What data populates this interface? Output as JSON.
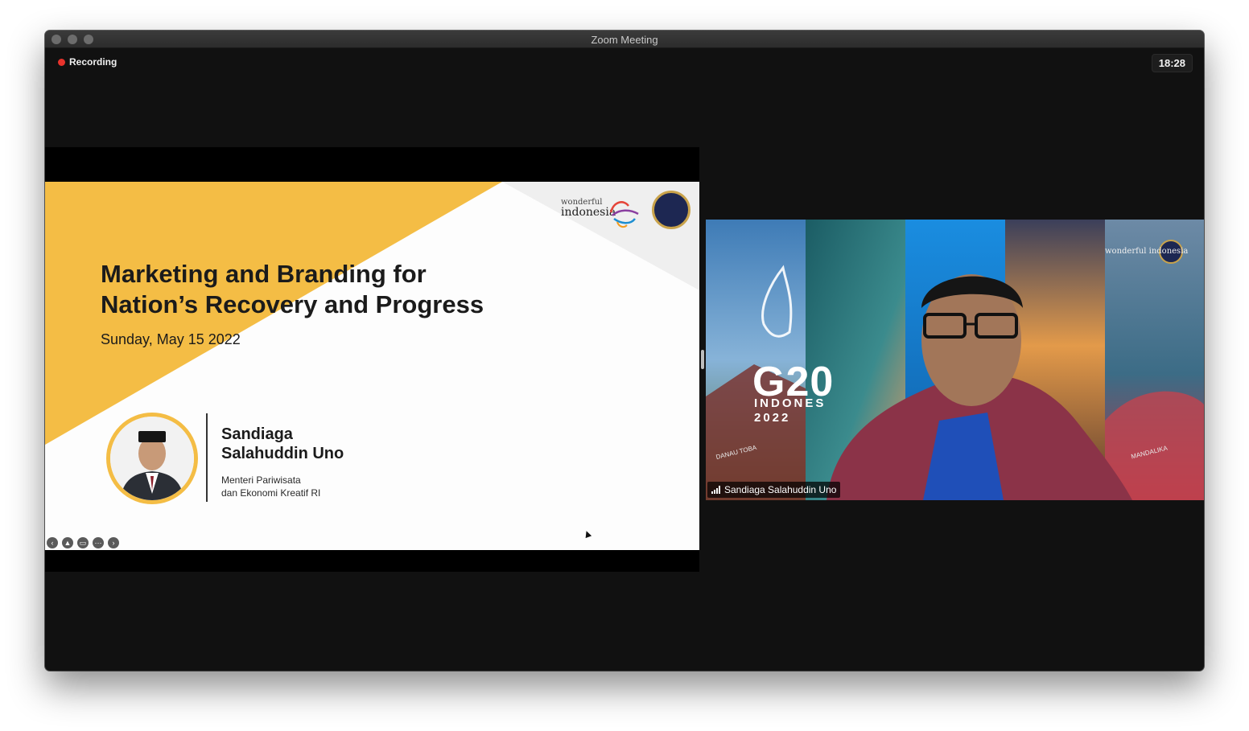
{
  "window": {
    "title": "Zoom Meeting"
  },
  "meeting": {
    "recording_label": "Recording",
    "timer": "18:28"
  },
  "slide": {
    "title_line1": "Marketing and Branding for",
    "title_line2": "Nation’s Recovery and Progress",
    "date": "Sunday, May 15 2022",
    "speaker_name_line1": "Sandiaga",
    "speaker_name_line2": "Salahuddin Uno",
    "speaker_role_line1": "Menteri Pariwisata",
    "speaker_role_line2": "dan Ekonomi Kreatif RI",
    "logo_small": "wonderful",
    "logo_big": "indonesia",
    "colors": {
      "accent_yellow": "#f4bd45"
    }
  },
  "video": {
    "participant_name": "Sandiaga Salahuddin Uno",
    "g20_text": "G20",
    "g20_country": "INDONES",
    "g20_year": "2022",
    "left_label": "DANAU TOBA",
    "right_label": "MANDALIKA",
    "background_logo": "wonderful indonesia"
  }
}
